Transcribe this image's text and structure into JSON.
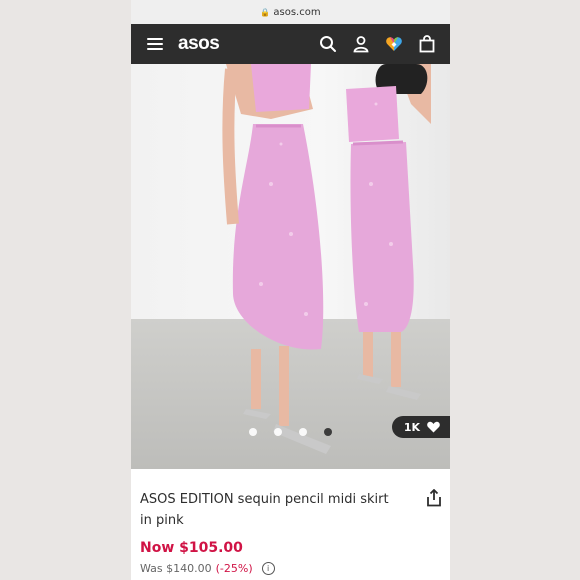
{
  "browser": {
    "url": "asos.com"
  },
  "header": {
    "logo": "asos",
    "icons": [
      "menu-icon",
      "search-icon",
      "account-icon",
      "saved-items-icon",
      "bag-icon"
    ]
  },
  "gallery": {
    "image_description": "product-photo-pink-sequin-skirt",
    "dot_count": 4,
    "active_dot": 3,
    "likes_label": "1K"
  },
  "product": {
    "title": "ASOS EDITION sequin pencil midi skirt in pink",
    "price_now": "Now $105.00",
    "was_prefix": "Was $140.00",
    "discount": "(-25%)"
  },
  "colors": {
    "header": "#2d2d2d",
    "sale": "#d01345",
    "skirt": "#e6a8da"
  }
}
